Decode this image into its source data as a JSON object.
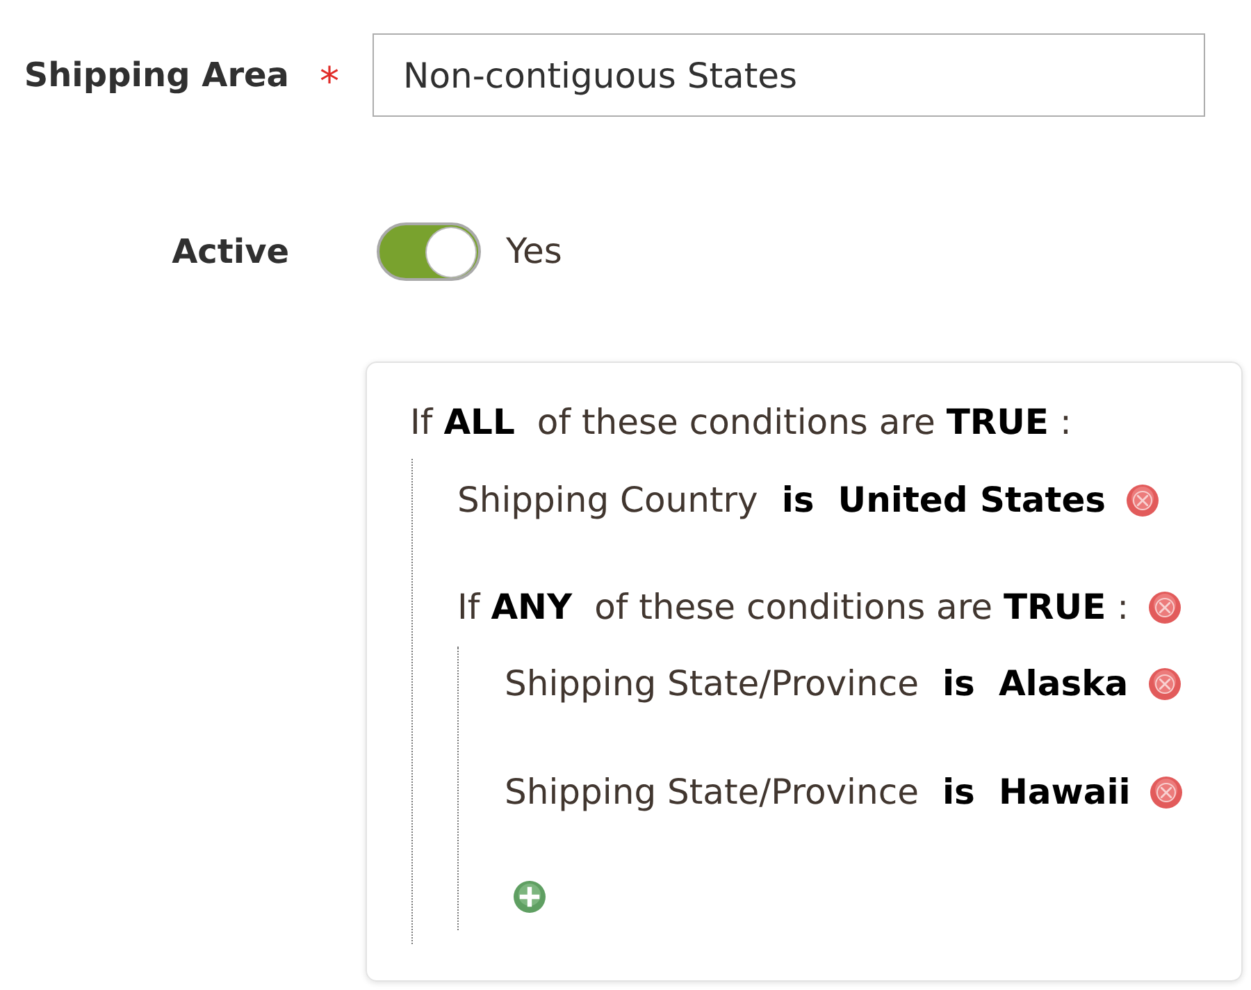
{
  "form": {
    "fields": [
      {
        "kind": "text",
        "label": "Shipping Area",
        "required_mark": "*",
        "value": "Non-contiguous States"
      },
      {
        "kind": "toggle",
        "label": "Active",
        "on": true,
        "state_text": "Yes"
      }
    ]
  },
  "conditions": {
    "prefix": "If",
    "aggregator": "ALL",
    "middle": "of these conditions are",
    "value": "TRUE",
    "suffix": ":",
    "children": [
      {
        "kind": "condition",
        "attribute": "Shipping Country",
        "operator": "is",
        "value": "United States",
        "removable": true
      },
      {
        "kind": "combine",
        "prefix": "If",
        "aggregator": "ANY",
        "middle": "of these conditions are",
        "value": "TRUE",
        "suffix": ":",
        "removable": true,
        "add_button": true,
        "children": [
          {
            "kind": "condition",
            "attribute": "Shipping State/Province",
            "operator": "is",
            "value": "Alaska",
            "removable": true
          },
          {
            "kind": "condition",
            "attribute": "Shipping State/Province",
            "operator": "is",
            "value": "Hawaii",
            "removable": true
          }
        ]
      }
    ]
  }
}
